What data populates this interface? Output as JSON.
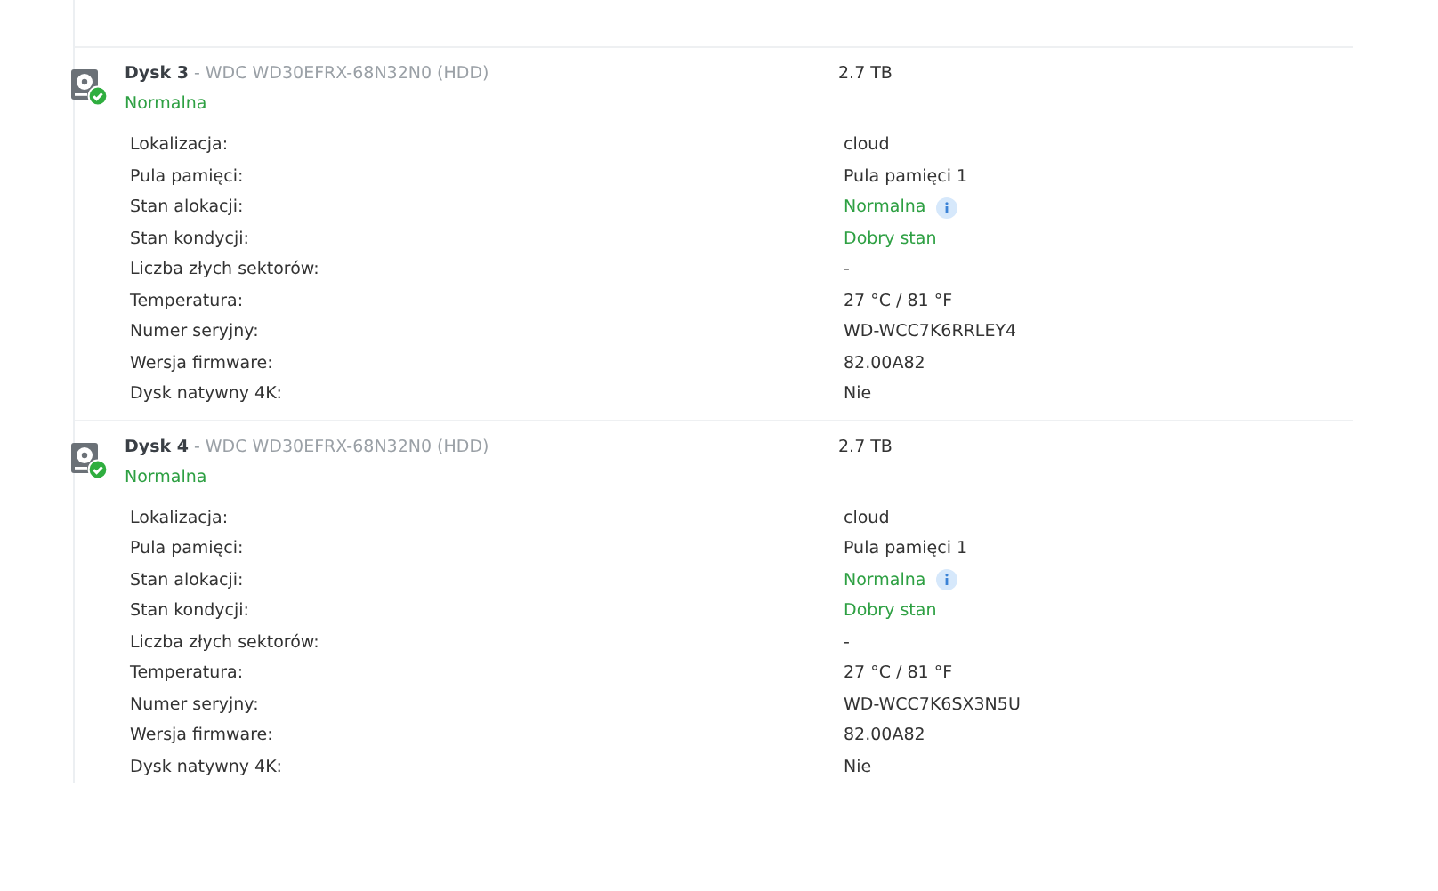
{
  "disks": [
    {
      "name": "Dysk 3",
      "model": "- WDC WD30EFRX-68N32N0 (HDD)",
      "status": "Normalna",
      "capacity": "2.7 TB",
      "rows": [
        {
          "label": "Lokalizacja:",
          "value": "cloud",
          "kind": "plain"
        },
        {
          "label": "Pula pamięci:",
          "value": "Pula pamięci 1",
          "kind": "plain"
        },
        {
          "label": "Stan alokacji:",
          "value": "Normalna",
          "kind": "good-info"
        },
        {
          "label": "Stan kondycji:",
          "value": "Dobry stan",
          "kind": "good"
        },
        {
          "label": "Liczba złych sektorów:",
          "value": "-",
          "kind": "plain"
        },
        {
          "label": "Temperatura:",
          "value": "27 °C / 81 °F",
          "kind": "plain"
        },
        {
          "label": "Numer seryjny:",
          "value": "WD-WCC7K6RRLEY4",
          "kind": "plain"
        },
        {
          "label": "Wersja firmware:",
          "value": "82.00A82",
          "kind": "plain"
        },
        {
          "label": "Dysk natywny 4K:",
          "value": "Nie",
          "kind": "plain"
        }
      ]
    },
    {
      "name": "Dysk 4",
      "model": "- WDC WD30EFRX-68N32N0 (HDD)",
      "status": "Normalna",
      "capacity": "2.7 TB",
      "rows": [
        {
          "label": "Lokalizacja:",
          "value": "cloud",
          "kind": "plain"
        },
        {
          "label": "Pula pamięci:",
          "value": "Pula pamięci 1",
          "kind": "plain"
        },
        {
          "label": "Stan alokacji:",
          "value": "Normalna",
          "kind": "good-info"
        },
        {
          "label": "Stan kondycji:",
          "value": "Dobry stan",
          "kind": "good"
        },
        {
          "label": "Liczba złych sektorów:",
          "value": "-",
          "kind": "plain"
        },
        {
          "label": "Temperatura:",
          "value": "27 °C / 81 °F",
          "kind": "plain"
        },
        {
          "label": "Numer seryjny:",
          "value": "WD-WCC7K6SX3N5U",
          "kind": "plain"
        },
        {
          "label": "Wersja firmware:",
          "value": "82.00A82",
          "kind": "plain"
        },
        {
          "label": "Dysk natywny 4K:",
          "value": "Nie",
          "kind": "plain"
        }
      ]
    }
  ]
}
